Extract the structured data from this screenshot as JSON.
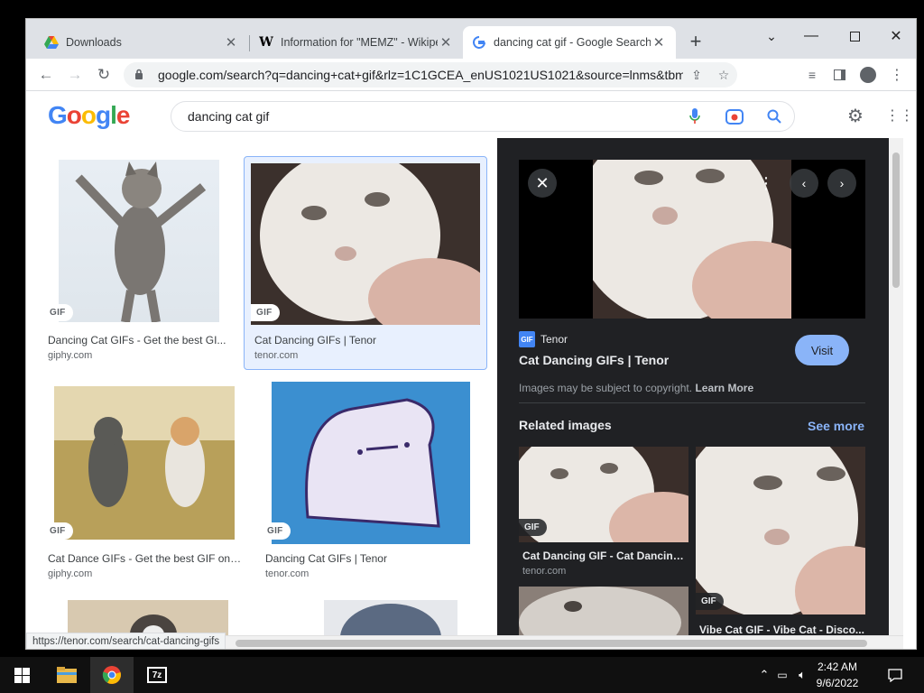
{
  "tabs": [
    {
      "title": "Downloads",
      "icon": "google-drive-icon"
    },
    {
      "title": "Information for \"MEMZ\" - Wikipe",
      "icon": "wikipedia-icon"
    },
    {
      "title": "dancing cat gif - Google Search",
      "icon": "google-icon"
    }
  ],
  "omnibox": {
    "url": "google.com/search?q=dancing+cat+gif&rlz=1C1GCEA_enUS1021US1021&source=lnms&tbm=isch&..."
  },
  "search": {
    "query": "dancing cat gif",
    "logo": "Google"
  },
  "results": [
    {
      "badge": "GIF",
      "title": "Dancing Cat GIFs - Get the best GI...",
      "source": "giphy.com"
    },
    {
      "badge": "GIF",
      "title": "Cat Dancing GIFs | Tenor",
      "source": "tenor.com"
    },
    {
      "badge": "GIF",
      "title": "Cat Dance GIFs - Get the best GIF on ...",
      "source": "giphy.com"
    },
    {
      "badge": "GIF",
      "title": "Dancing Cat GIFs | Tenor",
      "source": "tenor.com"
    }
  ],
  "panel": {
    "source_badge": "GIF",
    "source": "Tenor",
    "title": "Cat Dancing GIFs | Tenor",
    "visit_label": "Visit",
    "copyright": "Images may be subject to copyright.",
    "learn_more": "Learn More",
    "related_heading": "Related images",
    "see_more": "See more",
    "related": [
      {
        "badge": "GIF",
        "title": "Cat Dancing GIF - Cat Dancing ...",
        "source": "tenor.com"
      },
      {
        "badge": "GIF",
        "title": "Vibe Cat GIF - Vibe Cat - Disco..."
      }
    ]
  },
  "status_url": "https://tenor.com/search/cat-dancing-gifs",
  "clock": {
    "time": "2:42 AM",
    "date": "9/6/2022"
  },
  "colors": {
    "accent": "#8ab4f8",
    "panel_bg": "#202124",
    "google_blue": "#4285f4",
    "google_red": "#ea4335",
    "google_yellow": "#fbbc05",
    "google_green": "#34a853"
  }
}
